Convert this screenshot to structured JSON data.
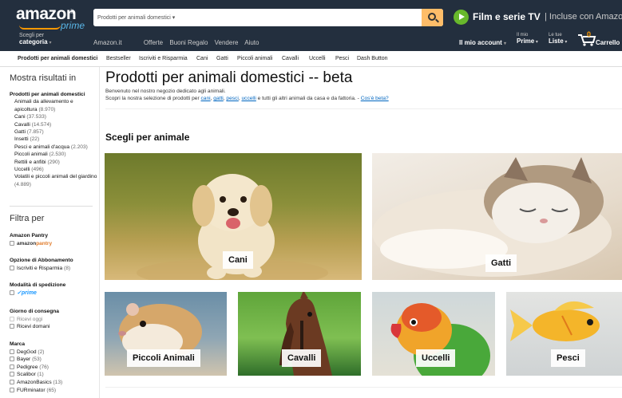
{
  "header": {
    "logo_text": "amazon",
    "logo_tld": ".it",
    "logo_prime": "prime",
    "search_department": "Prodotti per animali domestici",
    "promo_title": "Film e serie TV",
    "promo_sub": "| Incluse con Amazon Prime",
    "category_top": "Scegli per",
    "category_bottom": "categoria",
    "nav_links": [
      "Amazon.it",
      "Offerte",
      "Buoni Regalo",
      "Vendere",
      "Aiuto"
    ],
    "account": "Il mio account",
    "myprime_top": "Il mio",
    "myprime_bottom": "Prime",
    "lists_top": "Le tue",
    "lists_bottom": "Liste",
    "cart_count": "0",
    "cart_label": "Carrello"
  },
  "subnav": {
    "main": "Prodotti per animali domestici",
    "items": [
      "Bestseller",
      "Iscriviti e Risparmia",
      "Cani",
      "Gatti",
      "Piccoli animali",
      "Cavalli",
      "Uccelli",
      "Pesci",
      "Dash Button"
    ]
  },
  "sidebar": {
    "heading_results": "Mostra risultati in",
    "category_root": "Prodotti per animali domestici",
    "categories": [
      {
        "label": "Animali da allevamento e apicoltura",
        "count": "(8.970)"
      },
      {
        "label": "Cani",
        "count": "(37.533)"
      },
      {
        "label": "Cavalli",
        "count": "(14.574)"
      },
      {
        "label": "Gatti",
        "count": "(7.857)"
      },
      {
        "label": "Insetti",
        "count": "(22)"
      },
      {
        "label": "Pesci e animali d'acqua",
        "count": "(2.203)"
      },
      {
        "label": "Piccoli animali",
        "count": "(2.530)"
      },
      {
        "label": "Rettili e anfibi",
        "count": "(290)"
      },
      {
        "label": "Uccelli",
        "count": "(496)"
      },
      {
        "label": "Volatili e piccoli animali del giardino",
        "count": "(4.889)"
      }
    ],
    "heading_filter": "Filtra per",
    "pantry_title": "Amazon Pantry",
    "pantry_logo_a": "amazon",
    "pantry_logo_b": "pantry",
    "subscription_title": "Opzione di Abbonamento",
    "subscription_option": "Iscriviti e Risparmia",
    "subscription_count": "(8)",
    "shipping_title": "Modalità di spedizione",
    "shipping_prime": "prime",
    "delivery_title": "Giorno di consegna",
    "delivery_options": [
      "Ricevi oggi",
      "Ricevi domani"
    ],
    "brand_title": "Marca",
    "brands": [
      {
        "label": "DegGod",
        "count": "(2)"
      },
      {
        "label": "Bayer",
        "count": "(53)"
      },
      {
        "label": "Pedigree",
        "count": "(76)"
      },
      {
        "label": "Scalibor",
        "count": "(1)"
      },
      {
        "label": "AmazonBasics",
        "count": "(13)"
      },
      {
        "label": "FURminator",
        "count": "(65)"
      }
    ]
  },
  "main": {
    "title": "Prodotti per animali domestici -- beta",
    "intro_line1": "Benvenuto nel nostro negozio dedicato agli animali.",
    "intro_prefix": "Scopri la nostra selezione di prodotti per",
    "intro_links": [
      "cani",
      "gatti",
      "pesci",
      "uccelli"
    ],
    "intro_suffix": "e tutti gli altri animali da casa e da fattoria. -",
    "beta_link": "Cos'è beta?",
    "section_title": "Scegli per animale",
    "tiles": [
      "Cani",
      "Gatti",
      "Piccoli Animali",
      "Cavalli",
      "Uccelli",
      "Pesci"
    ]
  }
}
